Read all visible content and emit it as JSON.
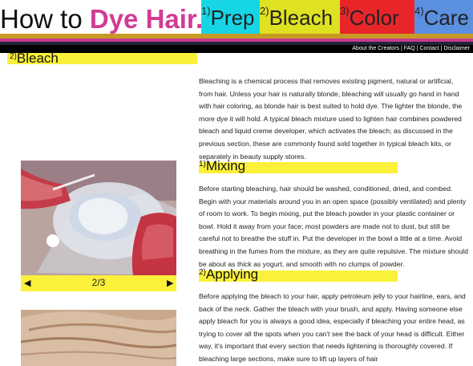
{
  "header": {
    "title_prefix": "How to ",
    "title_highlight": "Dye Hair.",
    "nav": [
      {
        "num": "1)",
        "label": "Prep"
      },
      {
        "num": "2)",
        "label": "Bleach"
      },
      {
        "num": "3)",
        "label": "Color"
      },
      {
        "num": "4)",
        "label": "Care"
      }
    ]
  },
  "utility_links": [
    "About the Creators",
    "FAQ",
    "Contact",
    "Disclaimer"
  ],
  "utility_sep": " | ",
  "section": {
    "num": "2)",
    "title": "Bleach"
  },
  "content": {
    "intro": "Bleaching is a chemical process that removes existing pigment, natural or artificial, from hair. Unless your hair is naturally blonde, bleaching will usually go hand in hand with hair coloring, as blonde hair is best suited to hold dye. The lighter the blonde, the more dye it will hold. A typical bleach mixture used to lighten hair combines powdered bleach and liquid creme developer, which activates the bleach; as discussed in the previous section, these are commonly found sold together in typical bleach kits, or separately in beauty supply stores.",
    "mixing": {
      "num": "1)",
      "title": "Mixing",
      "text": "Before starting bleaching, hair should be washed, conditioned, dried, and combed. Begin with your materials around you in an open space (possibly ventilated) and plenty of room to work. To begin mixing, put the bleach powder in your plastic container or bowl. Hold it away from your face; most powders are made not to dust, but still be careful not to breathe the stuff in. Put the developer in the bowl a little at a time. Avoid breathing in the fumes from the mixture, as they are quite repulsive. The mixture should be about as thick as yogurt, and smooth with no clumps of powder."
    },
    "applying": {
      "num": "2)",
      "title": "Applying",
      "text": "Before applying the bleach to your hair, apply petroleum jelly to your hairline, ears, and back of the neck. Gather the bleach with your brush, and apply. Having someone else apply bleach for you is always a good idea, especially if bleaching your entire head, as trying to cover all the spots when you can't see the back of your head is difficult. Either way, it's important that every section that needs lightening is thoroughly covered. If bleaching large sections, make sure to lift up layers of hair"
    }
  },
  "gallery": {
    "counter": "2/3",
    "prev_icon": "◀",
    "next_icon": "▶"
  },
  "colors": {
    "accent_pink": "#d23b95",
    "prep": "#16d6e6",
    "bleach": "#dfe220",
    "color": "#e8262a",
    "care": "#5b8fe0",
    "highlight_yellow": "#fbf03a"
  }
}
